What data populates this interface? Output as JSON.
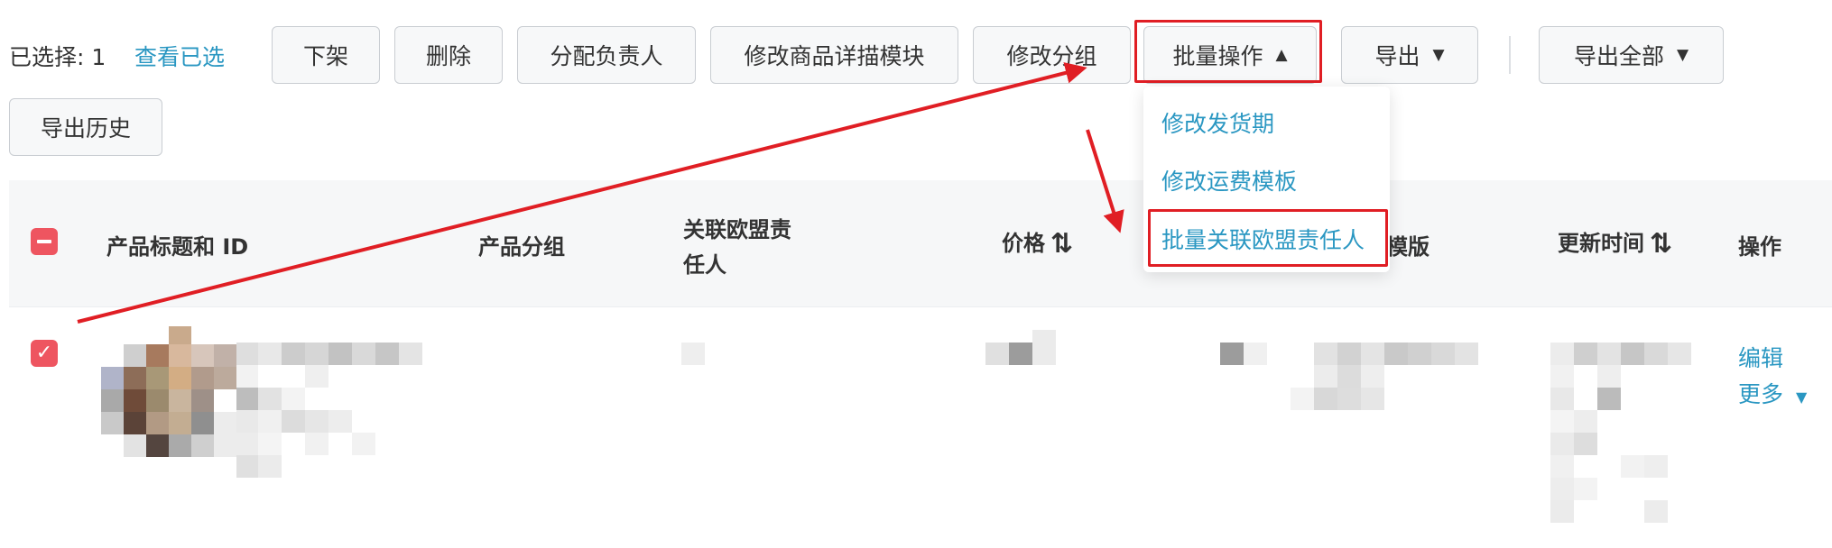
{
  "toolbar": {
    "selected_label": "已选择: 1",
    "view_selected_link": "查看已选",
    "buttons": {
      "delist": "下架",
      "delete": "删除",
      "assign_owner": "分配负责人",
      "edit_detail_module": "修改商品详描模块",
      "edit_group": "修改分组",
      "batch_ops": "批量操作",
      "export": "导出",
      "export_all": "导出全部",
      "export_history": "导出历史"
    }
  },
  "dropdown": {
    "items": [
      "修改发货期",
      "修改运费模板",
      "批量关联欧盟责任人"
    ]
  },
  "table": {
    "headers": {
      "title_id": "产品标题和 ID",
      "group": "产品分组",
      "eu_owner_line1": "关联欧盟责",
      "eu_owner_line2": "任人",
      "price": "价格",
      "template_fragment": "模版",
      "updated_time": "更新时间",
      "actions": "操作"
    },
    "row": {
      "actions": {
        "edit": "编辑",
        "more": "更多"
      }
    }
  },
  "icons": {
    "caret_down": "▼",
    "caret_up": "▲",
    "sort": "⇅"
  },
  "colors": {
    "accent_link": "#2a97c2",
    "checkbox": "#ee5560",
    "annotation_red": "#e01e24",
    "button_bg": "#f7f8f9",
    "header_bg": "#f6f7f8"
  }
}
